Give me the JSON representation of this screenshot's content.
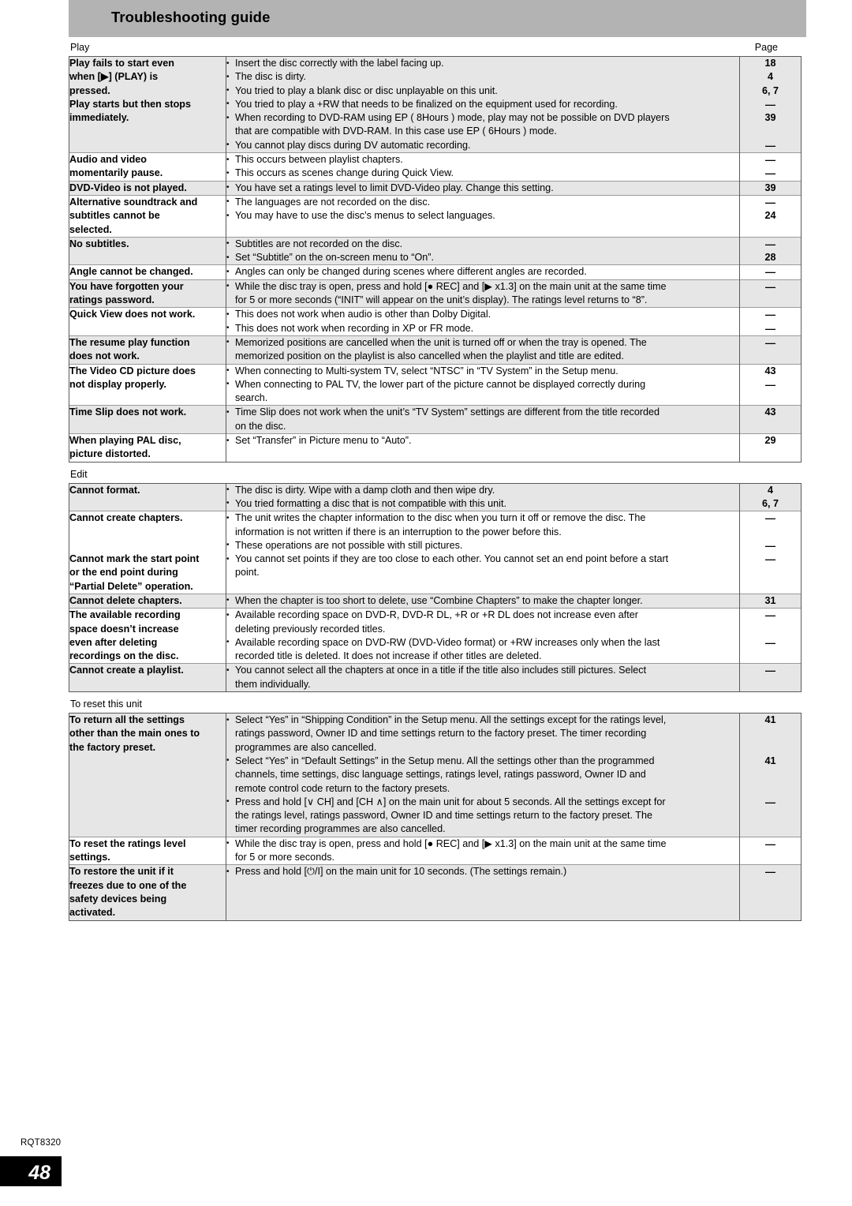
{
  "header": {
    "title": "Troubleshooting guide"
  },
  "page_column_label": "Page",
  "sections": [
    {
      "caption": "Play",
      "show_page_label": true,
      "rows": [
        {
          "shaded": true,
          "symptom": [
            "Play fails to start even",
            "when [▶] (PLAY) is",
            "pressed.",
            "Play starts but then stops",
            "immediately."
          ],
          "bullets": [
            {
              "lines": [
                "Insert the disc correctly with the label facing up."
              ],
              "page": "18"
            },
            {
              "lines": [
                "The disc is dirty."
              ],
              "page": "4"
            },
            {
              "lines": [
                "You tried to play a blank disc or disc unplayable on this unit."
              ],
              "page": "6, 7"
            },
            {
              "lines": [
                "You tried to play a +RW that needs to be finalized on the equipment used for recording."
              ],
              "page": "—"
            },
            {
              "lines": [
                "When recording to DVD-RAM using EP ( 8Hours ) mode, play may not be possible on DVD players",
                "that are compatible with DVD-RAM. In this case use EP ( 6Hours ) mode."
              ],
              "page": "39"
            },
            {
              "lines": [
                "You cannot play discs during DV automatic recording."
              ],
              "page": "—"
            }
          ]
        },
        {
          "shaded": false,
          "symptom": [
            "Audio and video",
            "momentarily pause."
          ],
          "bullets": [
            {
              "lines": [
                "This occurs between playlist chapters."
              ],
              "page": "—"
            },
            {
              "lines": [
                "This occurs as scenes change during Quick View."
              ],
              "page": "—"
            }
          ]
        },
        {
          "shaded": true,
          "symptom": [
            "DVD-Video is not played."
          ],
          "bullets": [
            {
              "lines": [
                "You have set a ratings level to limit DVD-Video play. Change this setting."
              ],
              "page": "39"
            }
          ]
        },
        {
          "shaded": false,
          "symptom": [
            "Alternative soundtrack and",
            "subtitles cannot be",
            "selected."
          ],
          "bullets": [
            {
              "lines": [
                "The languages are not recorded on the disc."
              ],
              "page": "—"
            },
            {
              "lines": [
                "You may have to use the disc’s menus to select languages."
              ],
              "page": "24"
            }
          ]
        },
        {
          "shaded": true,
          "symptom": [
            "No subtitles."
          ],
          "bullets": [
            {
              "lines": [
                "Subtitles are not recorded on the disc."
              ],
              "page": "—"
            },
            {
              "lines": [
                "Set “Subtitle” on the on-screen menu to “On”."
              ],
              "page": "28"
            }
          ]
        },
        {
          "shaded": false,
          "symptom": [
            "Angle cannot be changed."
          ],
          "bullets": [
            {
              "lines": [
                "Angles can only be changed during scenes where different angles are recorded."
              ],
              "page": "—"
            }
          ]
        },
        {
          "shaded": true,
          "symptom": [
            "You have forgotten your",
            "ratings password."
          ],
          "bullets": [
            {
              "lines": [
                "While the disc tray is open, press and hold [● REC] and [▶ x1.3] on the main unit at the same time",
                "for 5 or more seconds (“INIT” will appear on the unit’s display). The ratings level returns to “8”."
              ],
              "page": "—"
            }
          ]
        },
        {
          "shaded": false,
          "symptom": [
            "Quick View does not work."
          ],
          "bullets": [
            {
              "lines": [
                "This does not work when audio is other than Dolby Digital."
              ],
              "page": "—"
            },
            {
              "lines": [
                "This does not work when recording in XP or FR mode."
              ],
              "page": "—"
            }
          ]
        },
        {
          "shaded": true,
          "symptom": [
            "The resume play function",
            "does not work."
          ],
          "bullets": [
            {
              "lines": [
                "Memorized positions are cancelled when the unit is turned off or when the tray is opened. The",
                "memorized position on the playlist is also cancelled when the playlist and title are edited."
              ],
              "page": "—"
            }
          ]
        },
        {
          "shaded": false,
          "symptom": [
            "The Video CD picture does",
            "not display properly."
          ],
          "bullets": [
            {
              "lines": [
                "When connecting to Multi-system TV, select “NTSC” in “TV System” in the Setup menu."
              ],
              "page": "43"
            },
            {
              "lines": [
                "When connecting to PAL TV, the lower part of the picture cannot be displayed correctly during",
                "search."
              ],
              "page": "—"
            }
          ]
        },
        {
          "shaded": true,
          "symptom": [
            "Time Slip does not work."
          ],
          "bullets": [
            {
              "lines": [
                "Time Slip does not work when the unit’s “TV System” settings are different from the title recorded",
                "on the disc."
              ],
              "page": "43"
            }
          ]
        },
        {
          "shaded": false,
          "symptom": [
            "When playing PAL disc,",
            "picture distorted."
          ],
          "bullets": [
            {
              "lines": [
                "Set “Transfer” in Picture menu to “Auto”."
              ],
              "page": "29"
            }
          ]
        }
      ]
    },
    {
      "caption": "Edit",
      "show_page_label": false,
      "rows": [
        {
          "shaded": true,
          "symptom": [
            "Cannot format."
          ],
          "bullets": [
            {
              "lines": [
                "The disc is dirty. Wipe with a damp cloth and then wipe dry."
              ],
              "page": "4"
            },
            {
              "lines": [
                "You tried formatting a disc that is not compatible with this unit."
              ],
              "page": "6, 7"
            }
          ]
        },
        {
          "shaded": false,
          "symptom": [
            "Cannot create chapters.",
            "",
            "Cannot mark the start point",
            "or the end point during",
            "“Partial Delete” operation."
          ],
          "bullets": [
            {
              "lines": [
                "The unit writes the chapter information to the disc when you turn it off or remove the disc. The",
                "information is not written if there is an interruption to the power before this."
              ],
              "page": "—"
            },
            {
              "lines": [
                "These operations are not possible with still pictures."
              ],
              "page": "—"
            },
            {
              "lines": [
                "You cannot set points if they are too close to each other. You cannot set an end point before a start",
                "point."
              ],
              "page": "—"
            }
          ]
        },
        {
          "shaded": true,
          "symptom": [
            "Cannot delete chapters."
          ],
          "bullets": [
            {
              "lines": [
                "When the chapter is too short to delete, use “Combine Chapters” to make the chapter longer."
              ],
              "page": "31"
            }
          ]
        },
        {
          "shaded": false,
          "symptom": [
            "The available recording",
            "space doesn’t increase",
            "even after deleting",
            "recordings on the disc."
          ],
          "bullets": [
            {
              "lines": [
                "Available recording space on DVD-R, DVD-R DL, +R or +R DL does not increase even after",
                "deleting previously recorded titles."
              ],
              "page": "—"
            },
            {
              "lines": [
                "Available recording space on DVD-RW (DVD-Video format) or +RW increases only when the last",
                "recorded title is deleted. It does not increase if other titles are deleted."
              ],
              "page": "—"
            }
          ]
        },
        {
          "shaded": true,
          "symptom": [
            "Cannot create a playlist."
          ],
          "bullets": [
            {
              "lines": [
                "You cannot select all the chapters at once in a title if the title also includes still pictures. Select",
                "them individually."
              ],
              "page": "—"
            }
          ]
        }
      ]
    },
    {
      "caption": "To reset this unit",
      "show_page_label": false,
      "rows": [
        {
          "shaded": true,
          "symptom": [
            "To return all the settings",
            "other than the main ones to",
            "the factory preset."
          ],
          "bullets": [
            {
              "lines": [
                "Select “Yes” in “Shipping Condition” in the Setup menu. All the settings except for the ratings level,",
                "ratings password, Owner ID and time settings return to the factory preset. The timer recording",
                "programmes are also cancelled."
              ],
              "page": "41"
            },
            {
              "lines": [
                "Select “Yes” in “Default Settings” in the Setup menu. All the settings other than the programmed",
                "channels, time settings, disc language settings, ratings level, ratings password, Owner ID and",
                "remote control code return to the factory presets."
              ],
              "page": "41"
            },
            {
              "lines": [
                "Press and hold [∨ CH] and [CH ∧] on the main unit for about 5 seconds. All the settings except for",
                "the ratings level, ratings password, Owner ID and time settings return to the factory preset. The",
                "timer recording programmes are also cancelled."
              ],
              "page": "—"
            }
          ]
        },
        {
          "shaded": false,
          "symptom": [
            "To reset the ratings level",
            "settings."
          ],
          "bullets": [
            {
              "lines": [
                "While the disc tray is open, press and hold [● REC] and [▶ x1.3] on the main unit at the same time",
                "for 5 or more seconds."
              ],
              "page": "—"
            }
          ]
        },
        {
          "shaded": true,
          "symptom": [
            "To restore the unit if it",
            "freezes due to one of the",
            "safety devices being",
            "activated."
          ],
          "bullets": [
            {
              "lines": [
                "Press and hold [⏻/I] on the main unit for 10 seconds. (The settings remain.)"
              ],
              "page": "—"
            }
          ]
        }
      ]
    }
  ],
  "footer": {
    "code": "RQT8320",
    "page_number": "48"
  }
}
